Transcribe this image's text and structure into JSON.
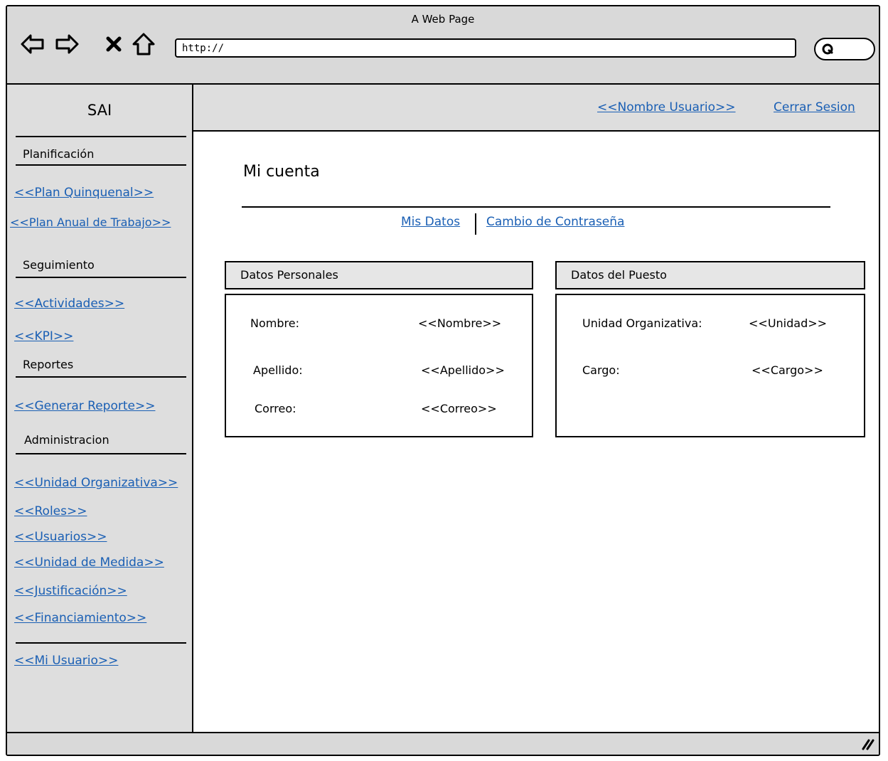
{
  "browser": {
    "title": "A Web Page",
    "url": "http://"
  },
  "sidebar": {
    "app_name": "SAI",
    "sections": [
      {
        "label": "Planificación",
        "links": [
          "<<Plan Quinquenal>>",
          "<<Plan Anual de Trabajo>>"
        ]
      },
      {
        "label": "Seguimiento",
        "links": [
          "<<Actividades>>",
          "<<KPI>>"
        ]
      },
      {
        "label": "Reportes",
        "links": [
          "<<Generar Reporte>>"
        ]
      },
      {
        "label": "Administracion",
        "links": [
          "<<Unidad Organizativa>>",
          "<<Roles>>",
          "<<Usuarios>>",
          "<<Unidad de Medida>>",
          "<<Justificación>>",
          "<<Financiamiento>>"
        ]
      }
    ],
    "footer_link": "<<Mi Usuario>>"
  },
  "header": {
    "user_link": "<<Nombre Usuario>>",
    "logout_link": "Cerrar Sesion"
  },
  "main": {
    "title": "Mi cuenta",
    "tabs": [
      "Mis Datos",
      "Cambio de Contraseña"
    ],
    "personal": {
      "heading": "Datos Personales",
      "fields": [
        {
          "label": "Nombre:",
          "value": "<<Nombre>>"
        },
        {
          "label": "Apellido:",
          "value": "<<Apellido>>"
        },
        {
          "label": "Correo:",
          "value": "<<Correo>>"
        }
      ]
    },
    "job": {
      "heading": "Datos del Puesto",
      "fields": [
        {
          "label": "Unidad Organizativa:",
          "value": "<<Unidad>>"
        },
        {
          "label": "Cargo:",
          "value": "<<Cargo>>"
        }
      ]
    }
  },
  "colors": {
    "link": "#1a5fb4",
    "chrome": "#d9d9d9",
    "panel_header": "#e6e6e6"
  },
  "icons": [
    "back-arrow-icon",
    "forward-arrow-icon",
    "close-x-icon",
    "home-icon",
    "search-icon",
    "resize-grip-icon"
  ]
}
